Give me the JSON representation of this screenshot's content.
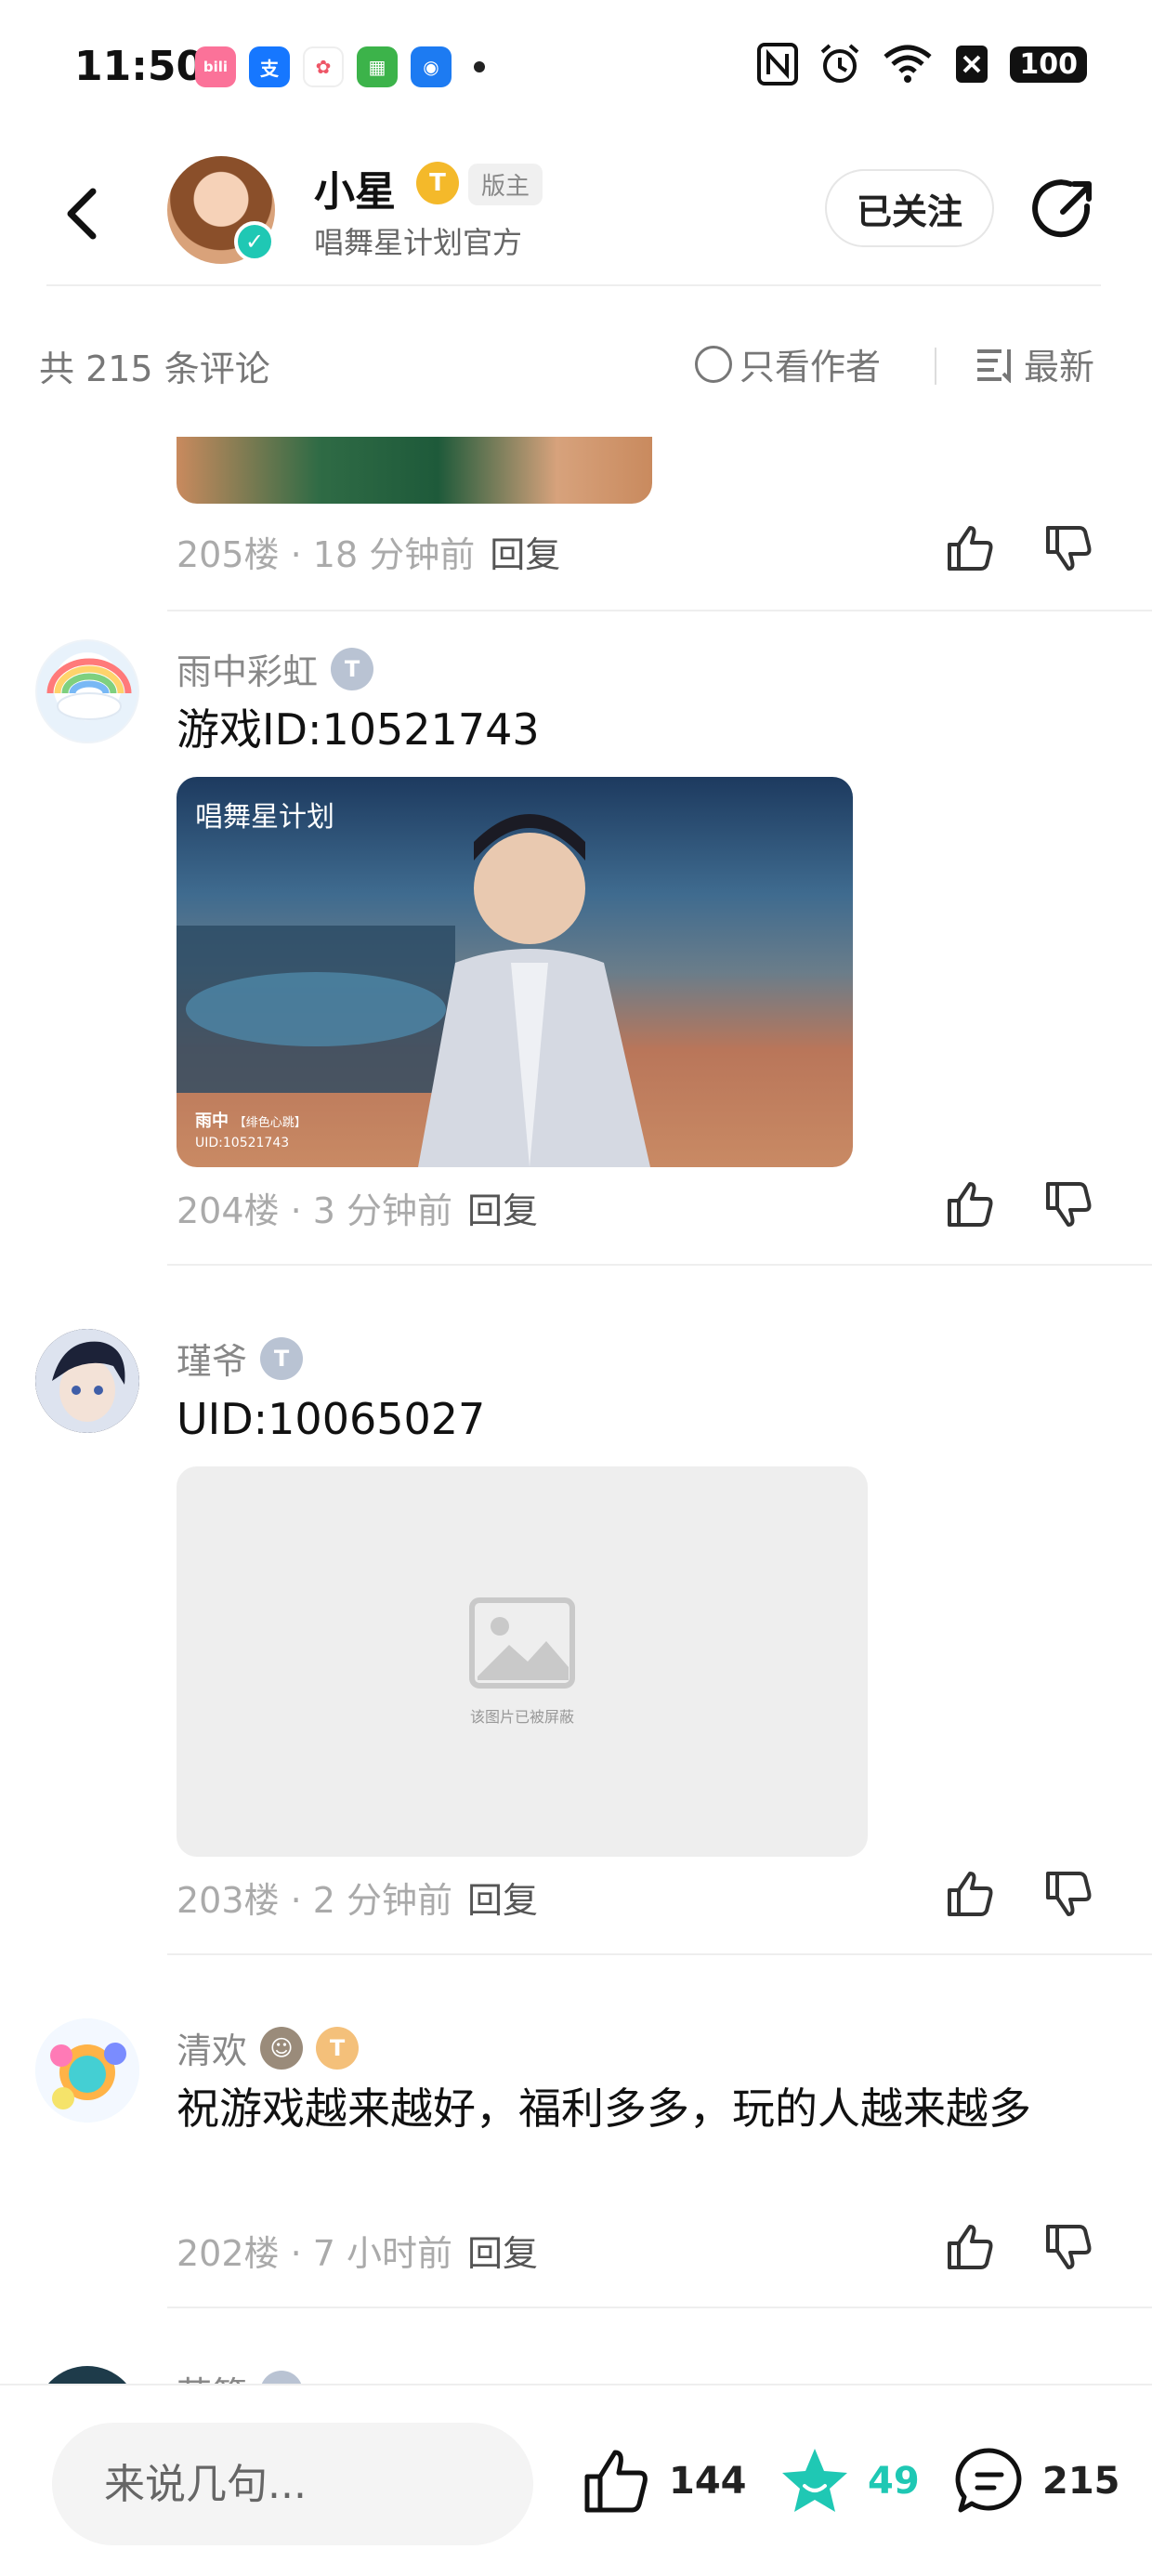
{
  "status_bar": {
    "time": "11:50",
    "app_icons": [
      {
        "name": "bilibili-icon",
        "glyph": "bili",
        "color": "#fb7299"
      },
      {
        "name": "alipay-icon",
        "glyph": "支",
        "color": "#1677ff"
      },
      {
        "name": "photos-icon",
        "glyph": "✿",
        "color": "#ffffff"
      },
      {
        "name": "app-store-icon",
        "glyph": "▦",
        "color": "#3cb34a"
      },
      {
        "name": "security-icon",
        "glyph": "◉",
        "color": "#1d7bf2"
      }
    ],
    "battery": "100"
  },
  "header": {
    "author_name": "小星",
    "level_badge": "T",
    "role_tag": "版主",
    "subtitle": "唱舞星计划官方",
    "follow_label": "已关注"
  },
  "filter": {
    "count_label": "共 215 条评论",
    "only_author_label": "只看作者",
    "sort_label": "最新"
  },
  "comments": [
    {
      "floor_time": "205楼 · 18 分钟前",
      "reply_label": "回复"
    },
    {
      "name": "雨中彩虹",
      "badge": "T",
      "text": "游戏ID:10521743",
      "image_watermark": "唱舞星计划",
      "image_caption_name": "雨中",
      "image_caption_role": "【绯色心跳】",
      "image_caption_uid": "UID:10521743",
      "floor_time": "204楼 · 3 分钟前",
      "reply_label": "回复"
    },
    {
      "name": "瑾爷",
      "badge": "T",
      "text": "UID:10065027",
      "blocked_text": "该图片已被屏蔽",
      "floor_time": "203楼 · 2 分钟前",
      "reply_label": "回复"
    },
    {
      "name": "清欢",
      "badge": "T",
      "text": "祝游戏越来越好，福利多多，玩的人越来越多",
      "floor_time": "202楼 · 7 小时前",
      "reply_label": "回复"
    },
    {
      "name": "若簌"
    }
  ],
  "bottom_bar": {
    "input_placeholder": "来说几句...",
    "like_count": "144",
    "star_count": "49",
    "comment_count": "215"
  },
  "colors": {
    "accent": "#1fc8b4",
    "gold_badge": "#f4b92a",
    "silver_badge": "#b9c3d3"
  }
}
